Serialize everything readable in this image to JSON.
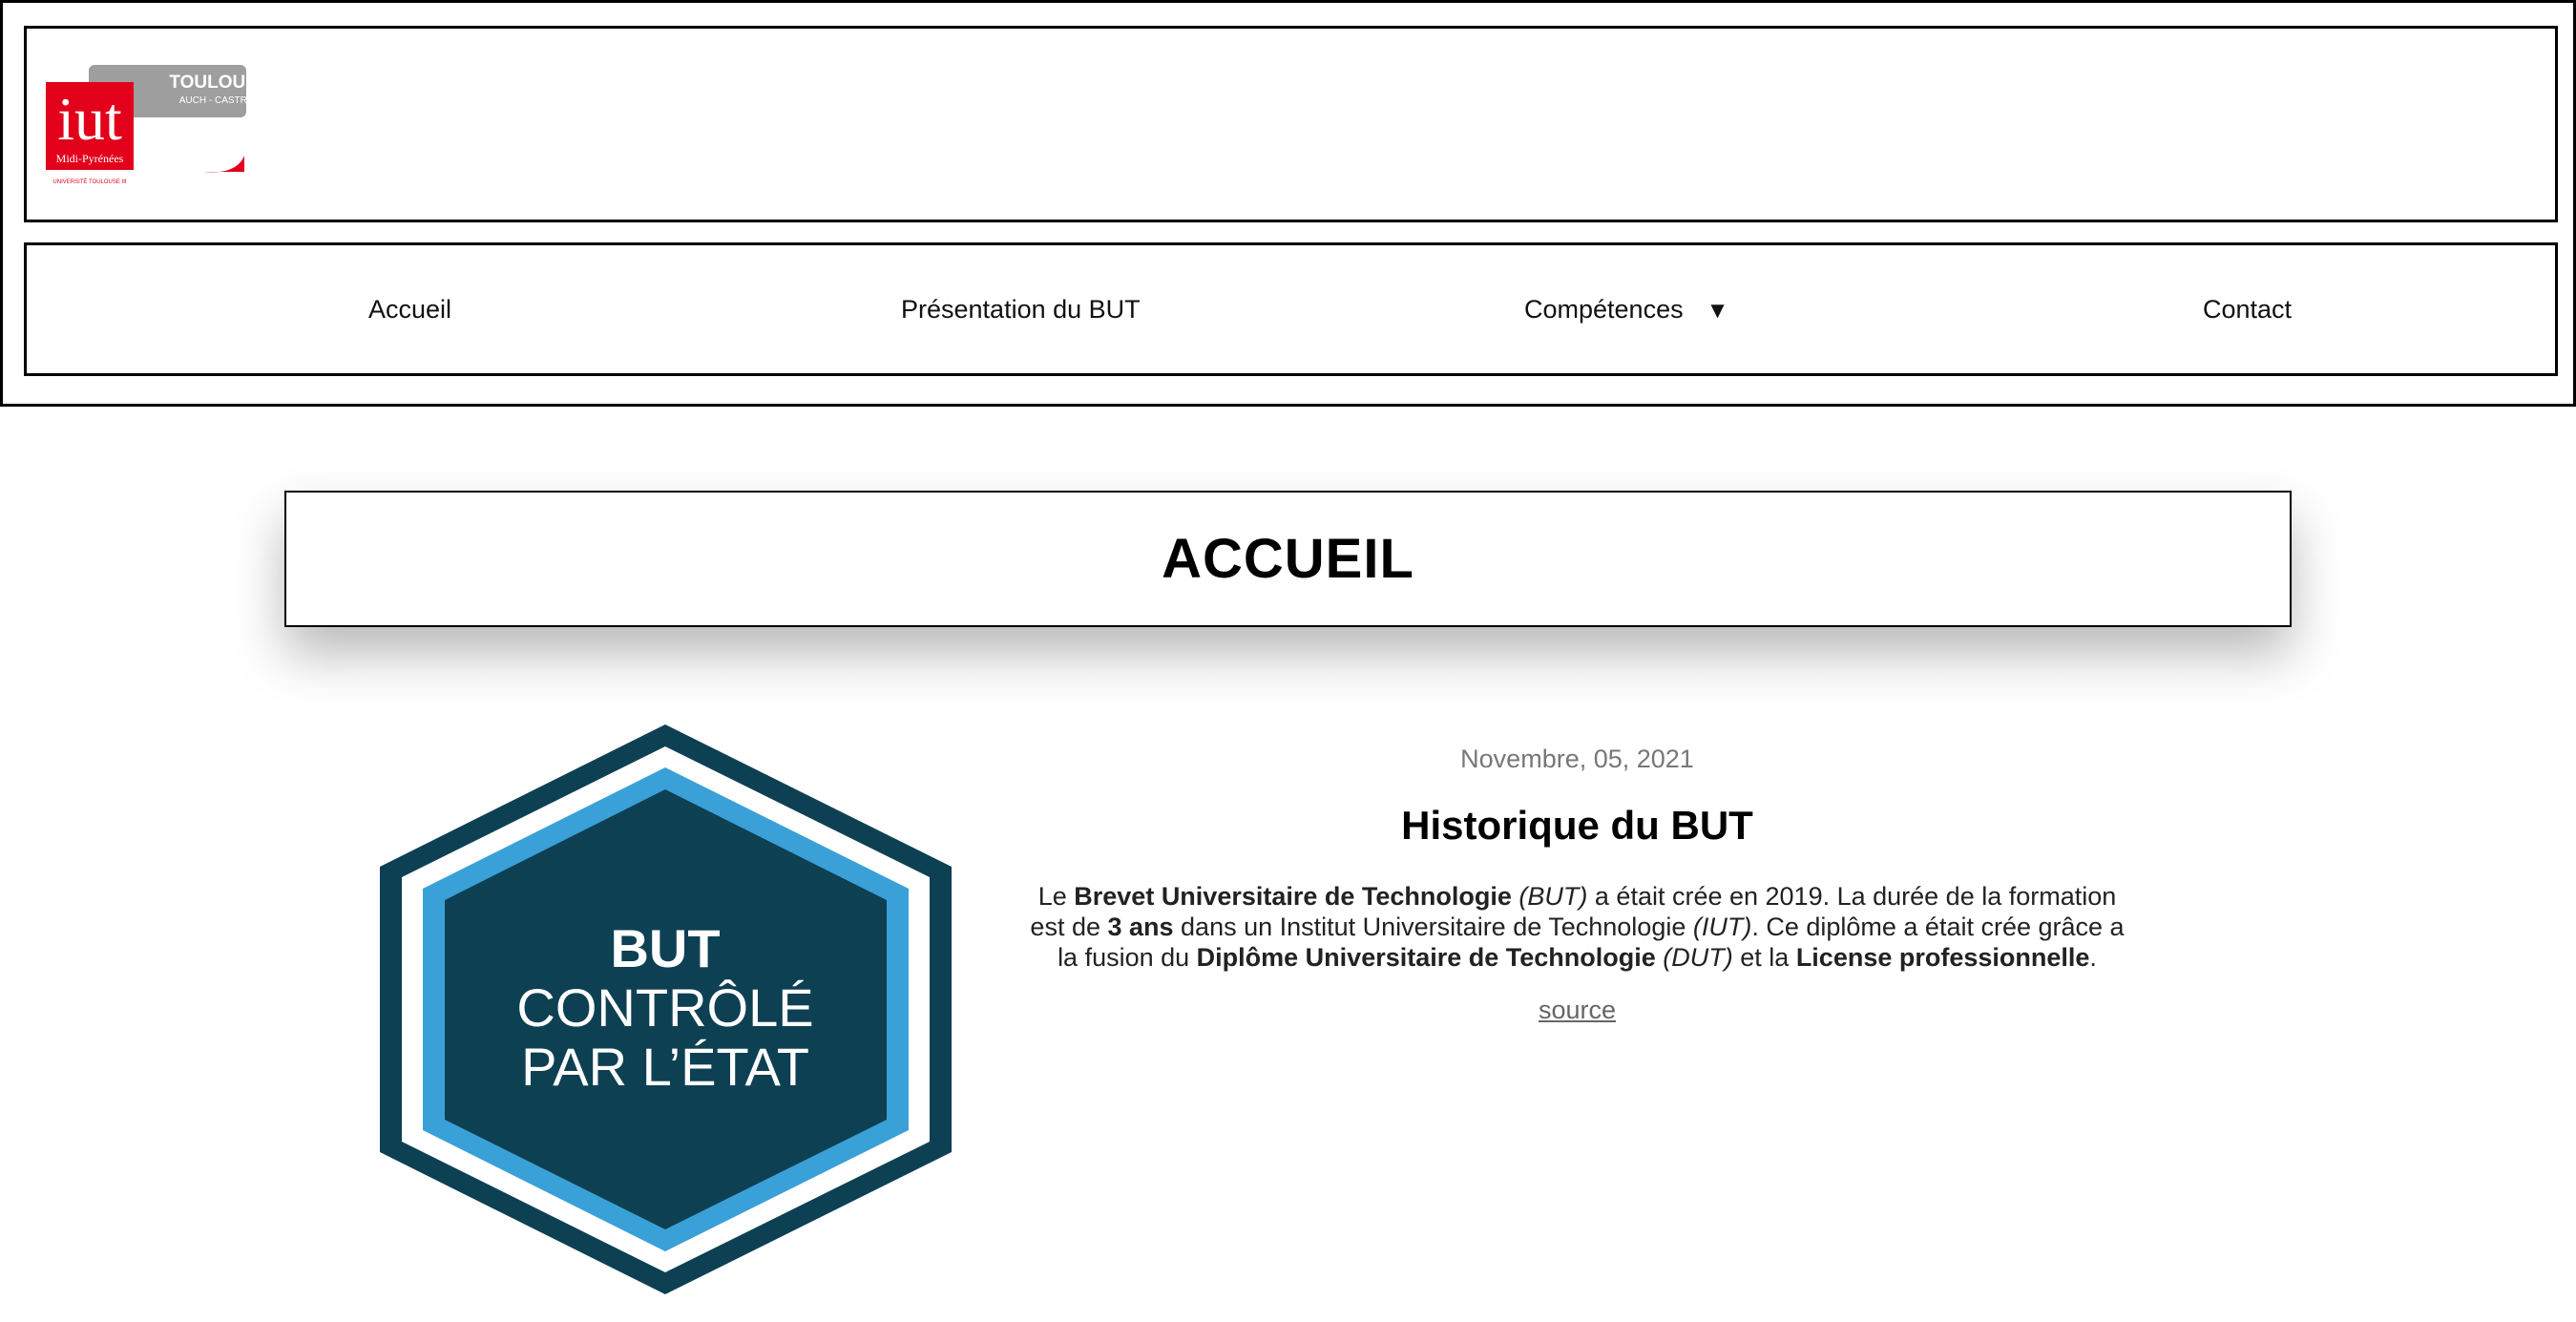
{
  "header": {
    "logo": {
      "main": "iut",
      "region": "Midi-Pyrénées",
      "city": "TOULOUSE",
      "sites": "AUCH - CASTRES",
      "university": "UNIVERSITÉ TOULOUSE III"
    }
  },
  "nav": {
    "items": [
      {
        "label": "Accueil"
      },
      {
        "label": "Présentation du BUT"
      },
      {
        "label": "Compétences",
        "arrow": "▼"
      },
      {
        "label": "Contact"
      }
    ]
  },
  "page": {
    "title": "ACCUEIL"
  },
  "badge": {
    "line1": "BUT",
    "line2": "CONTRÔLÉ",
    "line3": "PAR L’ÉTAT",
    "colors": {
      "dark": "#0e4053",
      "accent": "#3aa0d8"
    }
  },
  "article": {
    "date": "Novembre, 05, 2021",
    "heading": "Historique du BUT",
    "p": {
      "t1": "Le ",
      "b1": "Brevet Universitaire de Technologie",
      "i1": " (BUT)",
      "t2": " a était crée en 2019. La durée de la formation est de ",
      "b2": "3 ans",
      "t3": " dans un Institut Universitaire de Technologie ",
      "i2": "(IUT)",
      "t4": ". Ce diplôme a était crée grâce a la fusion du ",
      "b3": "Diplôme Universitaire de Technologie",
      "i3": " (DUT)",
      "t5": " et la ",
      "b4": "License professionnelle",
      "t6": "."
    },
    "source": "source"
  }
}
